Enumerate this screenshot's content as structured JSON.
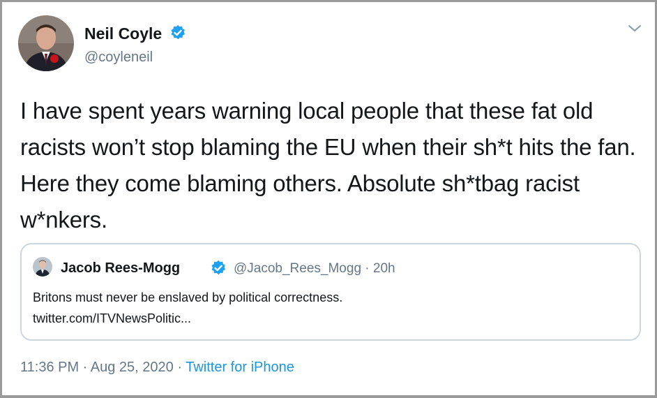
{
  "tweet": {
    "author": {
      "name": "Neil Coyle",
      "handle": "@coyleneil",
      "avatar_icon": "profile-photo",
      "verified_icon": "verified-badge-icon"
    },
    "text": "I have spent years warning local people that these fat old racists won’t stop blaming the EU when their sh*t hits the fan. Here they come blaming others. Absolute sh*tbag racist w*nkers.",
    "timestamp": "11:36 PM · Aug 25, 2020",
    "separator": " · ",
    "source": "Twitter for iPhone",
    "menu_icon": "chevron-down-icon"
  },
  "quoted_tweet": {
    "author": {
      "name": "Jacob Rees-Mogg",
      "handle": "@Jacob_Rees_Mogg",
      "age": "20h",
      "verified_icon": "verified-badge-icon"
    },
    "meta_separator": " · ",
    "text": "Britons must never be enslaved by political correctness.",
    "link": "twitter.com/ITVNewsPolitic..."
  },
  "colors": {
    "text": "#14171a",
    "secondary": "#657786",
    "accent": "#1b95e0",
    "verified": "#1da1f2",
    "border": "#ccd6dd"
  }
}
